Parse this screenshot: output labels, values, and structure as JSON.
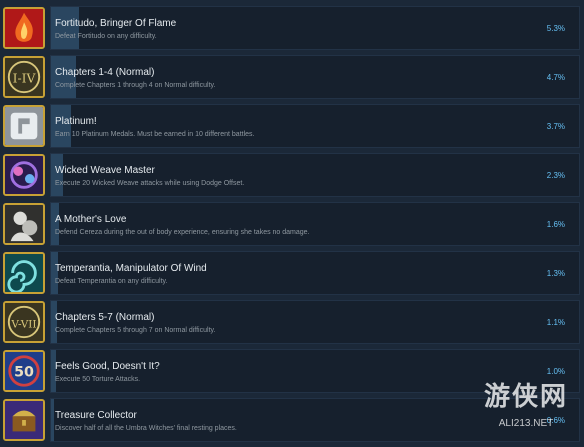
{
  "achievements": [
    {
      "title": "Fortitudo, Bringer Of Flame",
      "desc": "Defeat Fortitudo on any difficulty.",
      "percent": "5.3%",
      "fill": 5.3,
      "icon": "flame-icon",
      "colors": [
        "#b01818",
        "#f06a20"
      ]
    },
    {
      "title": "Chapters 1-4 (Normal)",
      "desc": "Complete Chapters 1 through 4 on Normal difficulty.",
      "percent": "4.7%",
      "fill": 4.7,
      "icon": "roman-numeral-i-iv-icon",
      "colors": [
        "#3a3520",
        "#d8c67a"
      ]
    },
    {
      "title": "Platinum!",
      "desc": "Earn 10 Platinum Medals. Must be earned in 10 different battles.",
      "percent": "3.7%",
      "fill": 3.7,
      "icon": "platinum-medal-icon",
      "colors": [
        "#8e949a",
        "#e8ecef"
      ]
    },
    {
      "title": "Wicked Weave Master",
      "desc": "Execute 20 Wicked Weave attacks while using Dodge Offset.",
      "percent": "2.3%",
      "fill": 2.3,
      "icon": "wicked-weave-icon",
      "colors": [
        "#2a1c4e",
        "#a070e0"
      ]
    },
    {
      "title": "A Mother's Love",
      "desc": "Defend Cereza during the out of body experience, ensuring she takes no damage.",
      "percent": "1.6%",
      "fill": 1.6,
      "icon": "mother-child-icon",
      "colors": [
        "#30302e",
        "#dcdcd8"
      ]
    },
    {
      "title": "Temperantia, Manipulator Of Wind",
      "desc": "Defeat Temperantia on any difficulty.",
      "percent": "1.3%",
      "fill": 1.3,
      "icon": "wind-swirl-icon",
      "colors": [
        "#0e4a4e",
        "#7fe0e0"
      ]
    },
    {
      "title": "Chapters 5-7 (Normal)",
      "desc": "Complete Chapters 5 through 7 on Normal difficulty.",
      "percent": "1.1%",
      "fill": 1.1,
      "icon": "roman-numeral-v-vii-icon",
      "colors": [
        "#3a3520",
        "#d8c67a"
      ]
    },
    {
      "title": "Feels Good, Doesn't It?",
      "desc": "Execute 50 Torture Attacks.",
      "percent": "1.0%",
      "fill": 1.0,
      "icon": "torture-50-icon",
      "colors": [
        "#1f3e8a",
        "#e8dcc0"
      ]
    },
    {
      "title": "Treasure Collector",
      "desc": "Discover half of all the Umbra Witches' final resting places.",
      "percent": "0.6%",
      "fill": 0.6,
      "icon": "treasure-chest-icon",
      "colors": [
        "#3a2a78",
        "#d2b04a"
      ]
    }
  ],
  "watermark": {
    "text": "游侠网",
    "url": "ALI213.NET"
  },
  "theme": {
    "accent": "#66c0f4",
    "bar": "#2a4660",
    "background": "#1b2838"
  }
}
